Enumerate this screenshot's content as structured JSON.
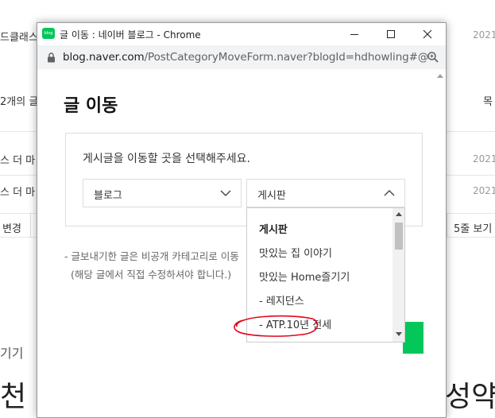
{
  "background": {
    "row1_text": "드클래스",
    "row1_date": "2021",
    "row2_text": "2개의 글",
    "row2_right": "목",
    "row3_text": "스 더 마",
    "row3_date": "2021",
    "row4_text": "스 더 마",
    "row4_date": "2021",
    "change_label": "변경",
    "view_label": "5줄 보기",
    "row5_text": "기기",
    "big_left": "천 글",
    "big_right": "성약"
  },
  "window": {
    "title": "글 이동 : 네이버 블로그 - Chrome",
    "favicon_text": "blog",
    "url_host": "blog.naver.com",
    "url_path": "/PostCategoryMoveForm.naver?blogId=hdhowling#@"
  },
  "dialog": {
    "title": "글 이동",
    "instruction": "게시글을 이동할 곳을 선택해주세요.",
    "blog_select": "블로그",
    "board_select": "게시판",
    "note1": "- 글보내기한 글은 비공개 카테고리로 이동",
    "note2": "(해당 글에서 직접 수정하셔야 합니다.)"
  },
  "dropdown": {
    "header": "게시판",
    "items": [
      "맛있는 집 이야기",
      "맛있는 Home즐기기",
      "- 레지던스",
      "- ATP.10년 전세"
    ]
  },
  "colors": {
    "brand_green": "#03c75a",
    "annotation_red": "#e3061b"
  },
  "icons": [
    "lock-icon",
    "zoom-icon",
    "minimize-icon",
    "maximize-icon",
    "close-icon",
    "chevron-down-icon",
    "chevron-up-icon"
  ]
}
